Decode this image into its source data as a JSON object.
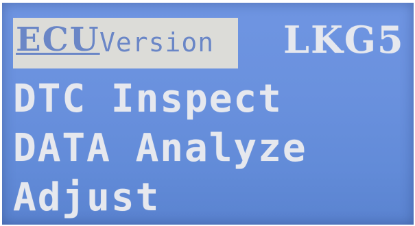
{
  "menu": {
    "selected_item": {
      "label_main": "ECU",
      "label_sub": "Version",
      "value": "LKG5"
    },
    "items": [
      {
        "label": "DTC Inspect"
      },
      {
        "label": "DATA Analyze"
      },
      {
        "label": "Adjust"
      }
    ]
  },
  "colors": {
    "screen_background": "#6a91de",
    "text": "#e6e8ee",
    "highlight_background": "#dcdcd8",
    "highlight_text": "#6a86c6"
  }
}
